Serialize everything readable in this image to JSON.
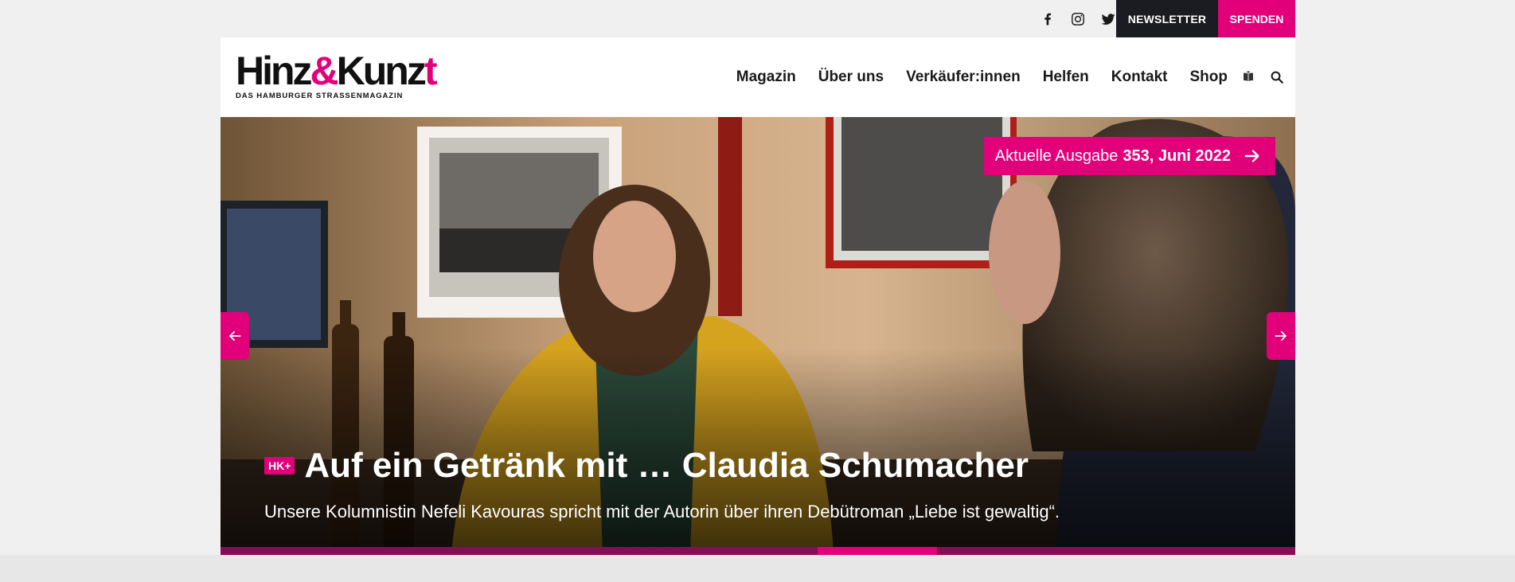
{
  "topbar": {
    "social": [
      {
        "icon": "facebook-icon",
        "name": "Facebook"
      },
      {
        "icon": "instagram-icon",
        "name": "Instagram"
      },
      {
        "icon": "twitter-icon",
        "name": "Twitter"
      }
    ],
    "newsletter_label": "NEWSLETTER",
    "spenden_label": "SPENDEN"
  },
  "header": {
    "logo": {
      "part1": "Hinz",
      "amp": "&",
      "part2": "Kunz",
      "part3": "t",
      "tagline": "DAS HAMBURGER STRASSENMAGAZIN"
    },
    "nav": [
      "Magazin",
      "Über uns",
      "Verkäufer:innen",
      "Helfen",
      "Kontakt",
      "Shop"
    ],
    "icons": [
      "book-icon",
      "search-icon"
    ]
  },
  "hero": {
    "issue_prefix": "Aktuelle Ausgabe",
    "issue_value": "353, Juni 2022",
    "badge": "HK+",
    "title": "Auf ein Getränk mit … Claudia Schumacher",
    "subtitle": "Unsere Kolumnistin Nefeli Kavouras spricht mit der Autorin über ihren Debütroman „Liebe ist gewaltig“.",
    "slider_position": 0.5
  },
  "colors": {
    "accent": "#e2007a",
    "dark": "#1b1b22",
    "background": "#f0f0f0"
  }
}
